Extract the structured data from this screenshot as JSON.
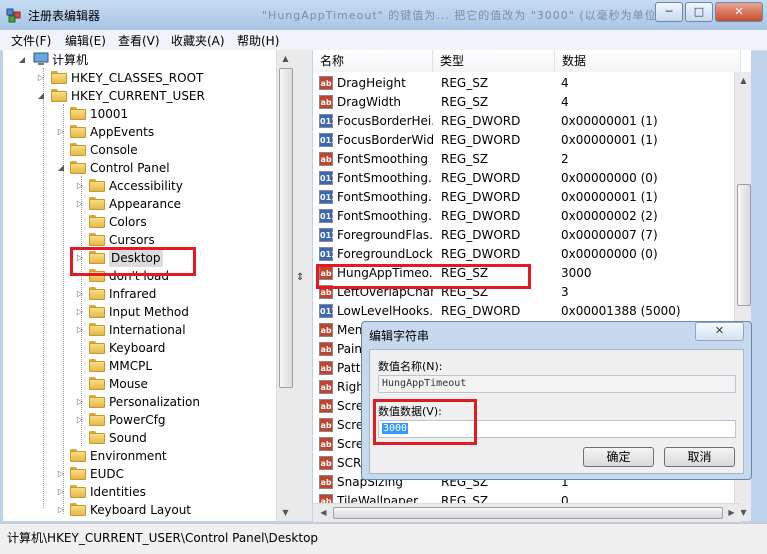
{
  "window": {
    "title": "注册表编辑器",
    "blurred_title": "\"HungAppTimeout\" 的键值为... 把它的值改为 \"3000\" (以毫秒为单位)",
    "minimize": "─",
    "maximize": "□",
    "close": "✕"
  },
  "menu": [
    {
      "label": "文件(F)"
    },
    {
      "label": "编辑(E)"
    },
    {
      "label": "查看(V)"
    },
    {
      "label": "收藏夹(A)"
    },
    {
      "label": "帮助(H)"
    }
  ],
  "tree": {
    "root": "计算机",
    "nodes": [
      {
        "label": "HKEY_CLASSES_ROOT"
      },
      {
        "label": "HKEY_CURRENT_USER"
      },
      {
        "label": "10001"
      },
      {
        "label": "AppEvents"
      },
      {
        "label": "Console"
      },
      {
        "label": "Control Panel"
      },
      {
        "label": "Accessibility"
      },
      {
        "label": "Appearance"
      },
      {
        "label": "Colors"
      },
      {
        "label": "Cursors"
      },
      {
        "label": "Desktop"
      },
      {
        "label": "don't load"
      },
      {
        "label": "Infrared"
      },
      {
        "label": "Input Method"
      },
      {
        "label": "International"
      },
      {
        "label": "Keyboard"
      },
      {
        "label": "MMCPL"
      },
      {
        "label": "Mouse"
      },
      {
        "label": "Personalization"
      },
      {
        "label": "PowerCfg"
      },
      {
        "label": "Sound"
      },
      {
        "label": "Environment"
      },
      {
        "label": "EUDC"
      },
      {
        "label": "Identities"
      },
      {
        "label": "Keyboard Layout"
      }
    ]
  },
  "columns": {
    "name": "名称",
    "type": "类型",
    "data": "数据"
  },
  "values": [
    {
      "icon": "ab",
      "name": "DragHeight",
      "type": "REG_SZ",
      "data": "4"
    },
    {
      "icon": "ab",
      "name": "DragWidth",
      "type": "REG_SZ",
      "data": "4"
    },
    {
      "icon": "011",
      "name": "FocusBorderHei...",
      "type": "REG_DWORD",
      "data": "0x00000001 (1)"
    },
    {
      "icon": "011",
      "name": "FocusBorderWid...",
      "type": "REG_DWORD",
      "data": "0x00000001 (1)"
    },
    {
      "icon": "ab",
      "name": "FontSmoothing",
      "type": "REG_SZ",
      "data": "2"
    },
    {
      "icon": "011",
      "name": "FontSmoothing...",
      "type": "REG_DWORD",
      "data": "0x00000000 (0)"
    },
    {
      "icon": "011",
      "name": "FontSmoothing...",
      "type": "REG_DWORD",
      "data": "0x00000001 (1)"
    },
    {
      "icon": "011",
      "name": "FontSmoothing...",
      "type": "REG_DWORD",
      "data": "0x00000002 (2)"
    },
    {
      "icon": "011",
      "name": "ForegroundFlas...",
      "type": "REG_DWORD",
      "data": "0x00000007 (7)"
    },
    {
      "icon": "011",
      "name": "ForegroundLock...",
      "type": "REG_DWORD",
      "data": "0x00000000 (0)"
    },
    {
      "icon": "ab",
      "name": "HungAppTimeo...",
      "type": "REG_SZ",
      "data": "3000"
    },
    {
      "icon": "ab",
      "name": "LeftOverlapChars",
      "type": "REG_SZ",
      "data": "3"
    },
    {
      "icon": "011",
      "name": "LowLevelHooks...",
      "type": "REG_DWORD",
      "data": "0x00001388 (5000)"
    },
    {
      "icon": "ab",
      "name": "Men",
      "type": "",
      "data": ""
    },
    {
      "icon": "ab",
      "name": "Pain",
      "type": "",
      "data": ""
    },
    {
      "icon": "ab",
      "name": "Patt",
      "type": "",
      "data": ""
    },
    {
      "icon": "ab",
      "name": "Righ",
      "type": "",
      "data": ""
    },
    {
      "icon": "ab",
      "name": "Scre",
      "type": "",
      "data": ""
    },
    {
      "icon": "ab",
      "name": "Scre",
      "type": "",
      "data": ""
    },
    {
      "icon": "ab",
      "name": "Scre",
      "type": "",
      "data": ""
    },
    {
      "icon": "ab",
      "name": "SCR",
      "type": "",
      "data": ""
    },
    {
      "icon": "ab",
      "name": "SnapSizing",
      "type": "REG_SZ",
      "data": "1"
    },
    {
      "icon": "ab",
      "name": "TileWallpaper",
      "type": "REG_SZ",
      "data": "0"
    }
  ],
  "status": "计算机\\HKEY_CURRENT_USER\\Control Panel\\Desktop",
  "dialog": {
    "title": "编辑字符串",
    "close": "✕",
    "name_label": "数值名称(N):",
    "name_value": "HungAppTimeout",
    "data_label": "数值数据(V):",
    "data_value": "3000",
    "ok": "确定",
    "cancel": "取消"
  },
  "accent": {
    "highlight": "#e21b23",
    "selection": "#3399ff",
    "titlebar": "#bcd3ea"
  }
}
